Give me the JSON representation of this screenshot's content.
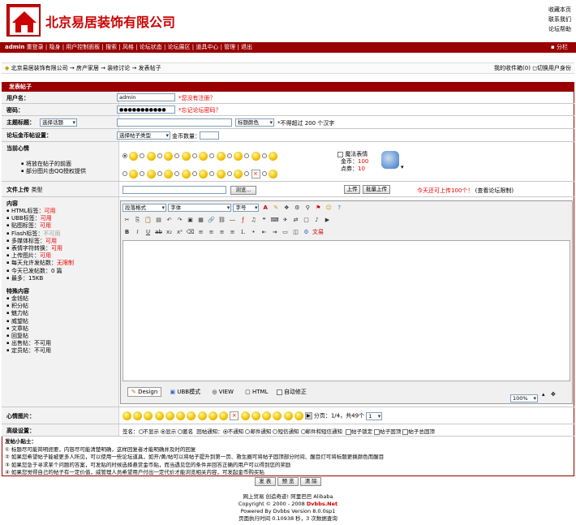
{
  "site": {
    "logo_text": "北京易居装饰有限公司",
    "top_links": [
      "收藏本页",
      "联系我们",
      "论坛帮助"
    ]
  },
  "nav": {
    "user": "admin",
    "items": [
      "重登录",
      "隐身",
      "用户控制面板",
      "搜索",
      "风格",
      "论坛状态",
      "论坛展区",
      "道具中心",
      "管理",
      "退出"
    ],
    "right": "分栏"
  },
  "breadcrumb": {
    "text": "北京易居装饰有限公司 → 房产家居 → 装修讨论 → 发表帖子",
    "inbox": "我的收件箱",
    "inbox_count": "(0)",
    "switch": "切换用户身份"
  },
  "form": {
    "header": "发表帖子",
    "username_label": "用户名：",
    "username_value": "admin",
    "username_hint": "*您没有注册？",
    "password_label": "密码：",
    "password_value": "●●●●●●●●●●●",
    "password_hint": "*忘记论坛密码？",
    "subject_label": "主题标题：",
    "subject_select": "选择话题",
    "subject_font": "标题颜色",
    "subject_hint": "*不得超过 200 个汉字",
    "reward_label": "论坛金币帖设置：",
    "reward_select": "选择帖子类型",
    "reward_qty": "金币数量：",
    "mood_label": "当前心情",
    "mood_items": [
      "将放在帖子的前面",
      "部分图片由QQ授权提供"
    ],
    "magic_label": "魔法表情",
    "coin_label": "金币：",
    "coin_value": "100",
    "point_label": "点券：",
    "point_value": "10",
    "upload_label": "文件上传",
    "upload_type": "类型",
    "browse_btn": "浏览...",
    "upload_btn": "上传",
    "batch_btn": "批量上传",
    "upload_today": "今天还可上传100个！",
    "upload_limit": "(查看论坛限制)",
    "content_label": "内容",
    "content_items": [
      {
        "k": "HTML标签：",
        "v": "可用"
      },
      {
        "k": "UBB标签：",
        "v": "可用"
      },
      {
        "k": "贴图标签：",
        "v": "可用"
      },
      {
        "k": "Flash标签：",
        "v": "不可用"
      },
      {
        "k": "多媒体标签：",
        "v": "可用"
      },
      {
        "k": "表情字符转换：",
        "v": "可用"
      },
      {
        "k": "上传图片：",
        "v": "可用"
      },
      {
        "k": "每天允许发帖数：",
        "v": "无限制"
      },
      {
        "k": "今天已发帖数：",
        "v": "0 篇"
      },
      {
        "k": "最多：",
        "v": "15KB"
      }
    ],
    "special_label": "特殊内容",
    "special_items": [
      "金钱帖",
      "积分帖",
      "魅力帖",
      "威望帖",
      "文章帖",
      "回复帖",
      "出售帖：不可用",
      "定员帖：不可用"
    ],
    "editor": {
      "format": "段落格式",
      "font": "字体",
      "size": "字号",
      "tabs": [
        "Design",
        "UBB模式",
        "VIEW",
        "HTML"
      ],
      "autofix": "自动修正",
      "zoom": "100%",
      "red_word": "文易"
    },
    "emoji_label": "心情图片：",
    "page_info": "分页：1/4，共49个",
    "page_sel": "1",
    "advanced_label": "高级设置：",
    "advanced": [
      "签名：",
      "不显示",
      "显示",
      "匿名",
      "回帖通知：",
      "不通知",
      "邮件通知",
      "短信通知",
      "邮件和短信通知",
      "帖子锁定",
      "帖子固顶",
      "帖子总固顶"
    ],
    "tips_title": "发帖小贴士：",
    "tips": [
      "① 标题尽可能简明扼要，内容尽可能清楚明确，这样回复者才能明确并及时的回复",
      "② 如果您希望帖子能被更多人所见，可以使用一些论坛道具，如开/黄/帖可以将帖子提升到第一页、救生圈可将帖子固顶部分时间、醒目灯可将标题更换颜色而醒目",
      "③ 如果您急于寻求某个问题的答案，可发贴的时候选择悬赏金币贴，而当遇见您的条件并回答正确的用户可以得到您的奖励",
      "④ 如果您觉得自己的帖子有一定价值，威管理人员希望用户付出一定代价才能浏览相关内容，可发起金币购买贴"
    ],
    "buttons": [
      "发 表",
      "预 览",
      "清 除"
    ]
  },
  "footer": {
    "links": "网上贸易  创造奇迹! 阿里巴巴 Alibaba",
    "copyright": "Copyright © 2000 - 2008",
    "brand": "Dvbbs.Net",
    "powered": "Powered By Dvbbs Version 8.0.0sp1",
    "exec": "页面执行时间 0.10938 秒，3 次数据查询"
  },
  "colors": {
    "nav": "#990000",
    "header": "#990000",
    "accent": "#cc0000"
  }
}
